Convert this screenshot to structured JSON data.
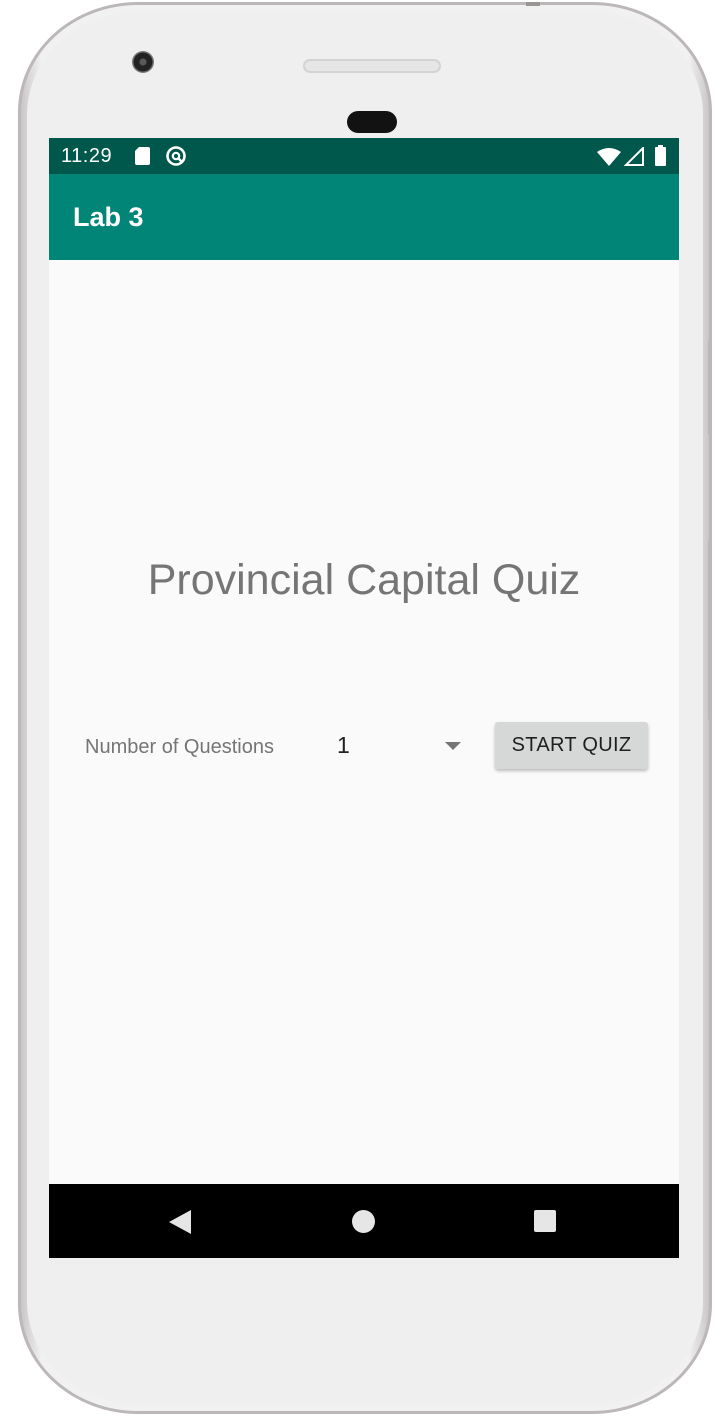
{
  "status_bar": {
    "time": "11:29",
    "icons": [
      "sd-card-icon",
      "sync-icon",
      "wifi-icon",
      "cell-signal-icon",
      "battery-icon"
    ]
  },
  "app_bar": {
    "title": "Lab 3"
  },
  "main": {
    "title": "Provincial Capital Quiz",
    "questions_label": "Number of Questions",
    "questions_spinner": {
      "selected": "1"
    },
    "start_button": "START QUIZ"
  },
  "nav_bar": {
    "icons": [
      "back-icon",
      "home-icon",
      "recents-icon"
    ]
  },
  "colors": {
    "status_bar": "#00574b",
    "app_bar": "#008577",
    "background": "#fafafa",
    "button": "#d6d7d7",
    "title_text": "#757575"
  }
}
